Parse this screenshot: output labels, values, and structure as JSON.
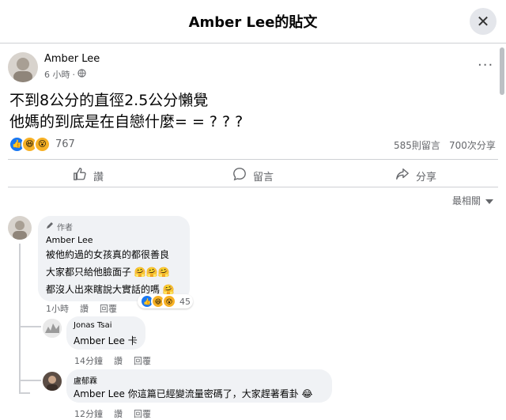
{
  "header": {
    "title": "Amber Lee的貼文",
    "close_icon": "✕"
  },
  "post": {
    "author": "Amber Lee",
    "time": "6 小時",
    "text_line1": "不到8公分的直徑2.5公分懶覺",
    "text_line2": "他媽的到底是在自戀什麼= = ? ? ?",
    "reaction_count": "767",
    "comment_count": "585則留言",
    "share_count": "700次分享"
  },
  "actions": {
    "like": "讚",
    "comment": "留言",
    "share": "分享"
  },
  "sort": {
    "label": "最相關"
  },
  "comments": [
    {
      "badge": "作者",
      "author": "Amber Lee",
      "line1": "被他約過的女孩真的都很善良",
      "line2": "大家都只給他臉面子",
      "line3": "都沒人出來瞎說大實話的嗎",
      "time": "1小時",
      "like": "讚",
      "reply": "回覆",
      "reaction_count": "45"
    }
  ],
  "replies": [
    {
      "author": "Jonas Tsai",
      "mention": "Amber Lee",
      "text": " 卡",
      "time": "14分鐘",
      "like": "讚",
      "reply": "回覆"
    },
    {
      "author": "盧郁霖",
      "mention": "Amber Lee",
      "text": " 你這篇已經變流量密碼了，大家趕著看卦",
      "time": "12分鐘",
      "like": "讚",
      "reply": "回覆"
    }
  ],
  "colors": {
    "like_blue": "#1877f2",
    "haha_yellow": "#f7b125",
    "text_gray": "#65676b"
  }
}
